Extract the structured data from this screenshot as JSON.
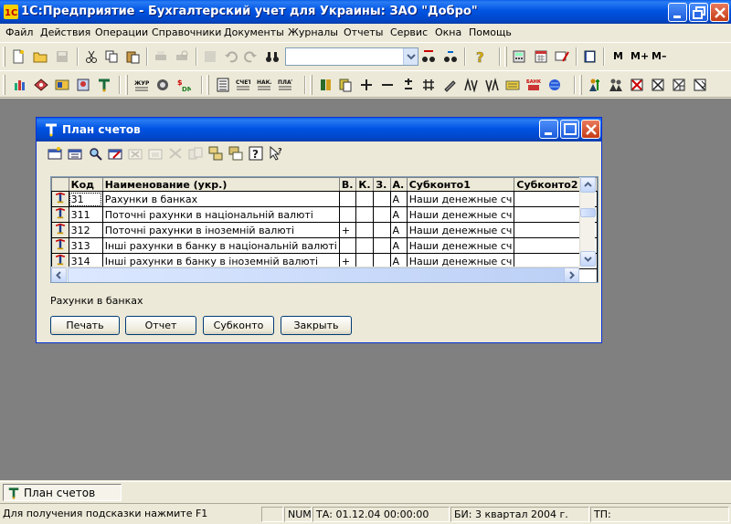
{
  "app": {
    "title": "1С:Предприятие - Бухгалтерский учет для Украины: ЗАО \"Добро\""
  },
  "menu": [
    "Файл",
    "Действия",
    "Операции",
    "Справочники",
    "Документы",
    "Журналы",
    "Отчеты",
    "Сервис",
    "Окна",
    "Помощь"
  ],
  "toolbar": {
    "combo_value": "",
    "mem_labels": [
      "M",
      "M+",
      "M–"
    ]
  },
  "window": {
    "title": "План счетов",
    "table": {
      "columns": [
        "Код",
        "Наименование (укр.)",
        "В.",
        "К.",
        "З.",
        "А.",
        "Субконто1",
        "Субконто2"
      ],
      "rows": [
        {
          "code": "31",
          "name": "Рахунки в банках",
          "v": "",
          "k": "",
          "z": "",
          "a": "А",
          "sub1": "Наши денежные сч",
          "sub2": ""
        },
        {
          "code": "311",
          "name": "Поточні рахунки в національній валюті",
          "v": "",
          "k": "",
          "z": "",
          "a": "А",
          "sub1": "Наши денежные сч",
          "sub2": ""
        },
        {
          "code": "312",
          "name": "Поточні рахунки в іноземній валюті",
          "v": "+",
          "k": "",
          "z": "",
          "a": "А",
          "sub1": "Наши денежные сч",
          "sub2": ""
        },
        {
          "code": "313",
          "name": "Інші рахунки в банку в національній валюті",
          "v": "",
          "k": "",
          "z": "",
          "a": "А",
          "sub1": "Наши денежные сч",
          "sub2": ""
        },
        {
          "code": "314",
          "name": "Інші рахунки в банку в іноземній валюті",
          "v": "+",
          "k": "",
          "z": "",
          "a": "А",
          "sub1": "Наши денежные сч",
          "sub2": ""
        }
      ]
    },
    "selected_description": "Рахунки в банках",
    "buttons": [
      "Печать",
      "Отчет",
      "Субконто",
      "Закрыть"
    ]
  },
  "taskbar": {
    "tab_label": "План счетов"
  },
  "statusbar": {
    "hint": "Для получения подсказки нажмите F1",
    "num": "NUM",
    "ta": "ТА: 01.12.04  00:00:00",
    "bi": "БИ: 3 квартал 2004 г.",
    "tp": "ТП:"
  },
  "colors": {
    "title_blue": "#0054e3",
    "workspace_gray": "#808080",
    "face": "#ece9d8"
  }
}
